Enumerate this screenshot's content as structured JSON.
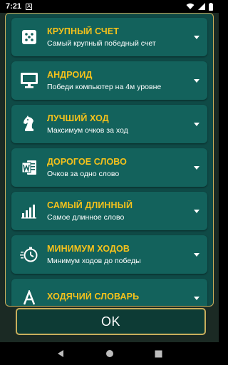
{
  "status_bar": {
    "time": "7:21",
    "notification_letter": "A"
  },
  "items": [
    {
      "icon": "dice-icon",
      "title": "КРУПНЫЙ СЧЕТ",
      "subtitle": "Самый крупный победный счет"
    },
    {
      "icon": "monitor-icon",
      "title": "АНДРОИД",
      "subtitle": "Победи компьютер на 4м уровне"
    },
    {
      "icon": "chess-knight-icon",
      "title": "ЛУЧШИЙ ХОД",
      "subtitle": "Максимум очков за ход"
    },
    {
      "icon": "word-document-icon",
      "title": "ДОРОГОЕ СЛОВО",
      "subtitle": "Очков за одно слово"
    },
    {
      "icon": "bar-chart-icon",
      "title": "САМЫЙ ДЛИННЫЙ",
      "subtitle": "Самое длинное слово"
    },
    {
      "icon": "stopwatch-icon",
      "title": "МИНИМУМ ХОДОВ",
      "subtitle": "Минимум ходов до победы"
    },
    {
      "icon": "font-icon",
      "title": "ХОДЯЧИЙ СЛОВАРЬ",
      "subtitle": ""
    }
  ],
  "ok_button": {
    "label": "OK"
  },
  "colors": {
    "accent_gold": "#f6c21b",
    "border_gold": "#c9ae5c",
    "dialog_bg": "#0f4a46",
    "card_bg": "#13625c"
  }
}
